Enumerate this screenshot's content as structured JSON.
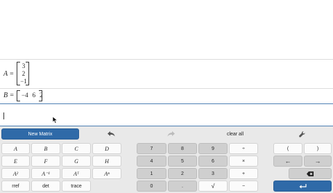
{
  "expressions": {
    "a_label": "A =",
    "a_values": [
      "3",
      "2",
      "−1"
    ],
    "b_label": "B =",
    "b_values": [
      "−4",
      "6",
      "2"
    ]
  },
  "toolbar": {
    "new_matrix": "New Matrix",
    "clear_all": "clear all",
    "undo_icon": "undo-icon",
    "redo_icon": "redo-icon",
    "settings_icon": "wrench-icon"
  },
  "keys": {
    "letters": [
      "A",
      "B",
      "C",
      "D",
      "E",
      "F",
      "G",
      "H"
    ],
    "a_square": "A²",
    "a_inverse": "A⁻¹",
    "a_transpose": "Aᵀ",
    "a_power": "Aⁿ",
    "rref": "rref",
    "det": "det",
    "trace": "trace",
    "digits": [
      "7",
      "8",
      "9",
      "4",
      "5",
      "6",
      "1",
      "2",
      "3",
      "0",
      "."
    ],
    "divide": "÷",
    "times": "×",
    "plus": "+",
    "minus": "−",
    "sqrt": "√",
    "lparen": "(",
    "rparen": ")",
    "left_arrow": "←",
    "right_arrow": "→",
    "backspace_icon": "backspace-icon",
    "enter_icon": "enter-icon"
  },
  "colors": {
    "accent": "#2f6aa8",
    "keypad_bg": "#e9e9e9",
    "number_key": "#cfcfcf"
  }
}
